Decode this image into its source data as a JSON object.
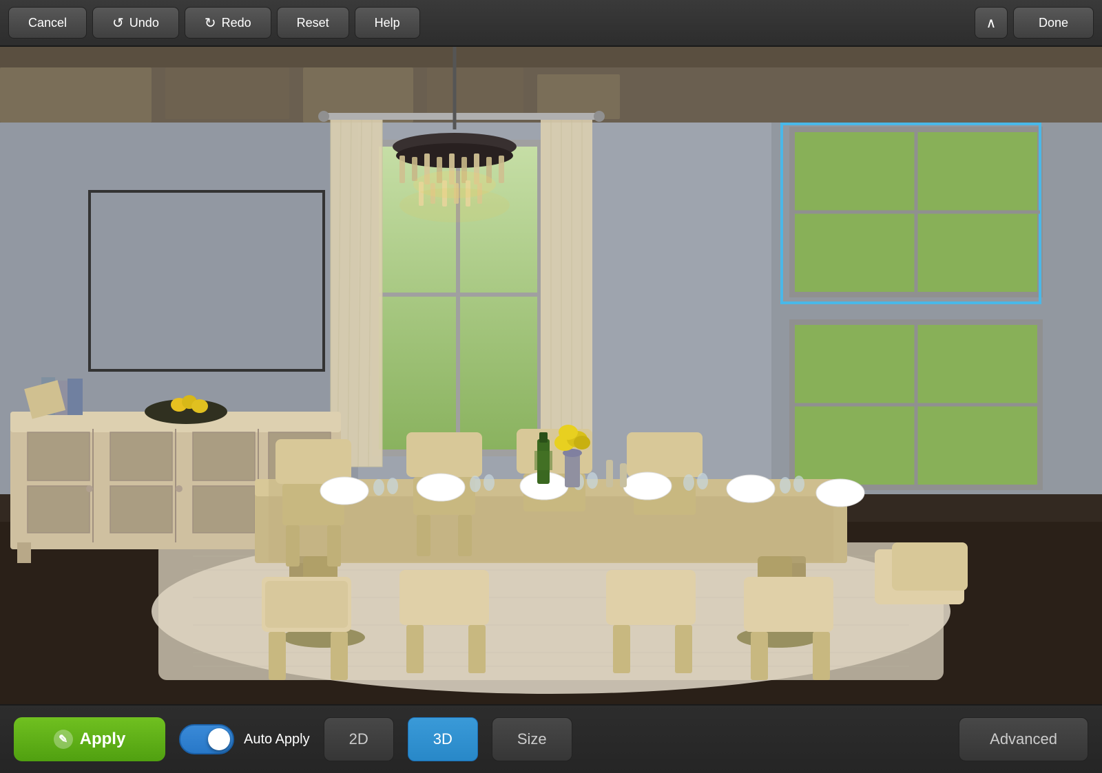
{
  "toolbar": {
    "cancel_label": "Cancel",
    "undo_label": "Undo",
    "redo_label": "Redo",
    "reset_label": "Reset",
    "help_label": "Help",
    "done_label": "Done",
    "chevron_symbol": "∧"
  },
  "bottom_bar": {
    "apply_label": "Apply",
    "auto_apply_label": "Auto Apply",
    "view_2d_label": "2D",
    "view_3d_label": "3D",
    "size_label": "Size",
    "advanced_label": "Advanced",
    "active_view": "3D"
  },
  "scene": {
    "has_artwork_frame": true,
    "has_blue_selection": true
  },
  "colors": {
    "toolbar_bg": "#2d2d2d",
    "apply_green": "#5bb820",
    "active_blue": "#3090d0",
    "toggle_blue": "#3080c8",
    "selection_border": "#4ab8e8"
  }
}
